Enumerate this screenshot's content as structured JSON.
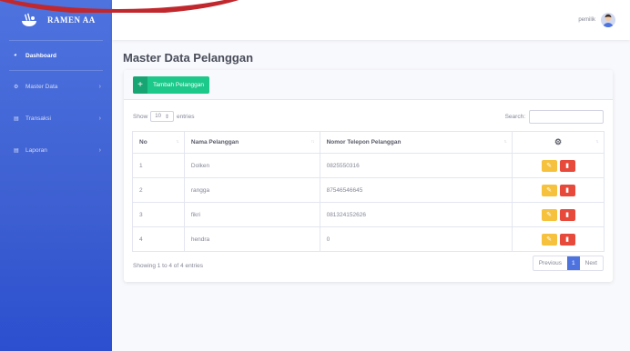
{
  "brand": {
    "name": "RAMEN AA",
    "icon": "ramen-logo-icon"
  },
  "sidebar": {
    "items": [
      {
        "label": "Dashboard",
        "icon": "dashboard-icon"
      },
      {
        "label": "Master Data",
        "icon": "gear-icon"
      },
      {
        "label": "Transaksi",
        "icon": "chart-icon"
      },
      {
        "label": "Laporan",
        "icon": "chart-icon"
      }
    ]
  },
  "topbar": {
    "username": "pemilik",
    "avatar_icon": "user-avatar-icon"
  },
  "page": {
    "title": "Master Data Pelanggan"
  },
  "card": {
    "add_label": "Tambah Pelanggan",
    "show_label": "Show",
    "entries_value": "10",
    "entries_label": "entries",
    "search_label": "Search:",
    "search_value": ""
  },
  "table": {
    "headers": [
      "No",
      "Nama Pelanggan",
      "Nomor Telepon Pelanggan"
    ],
    "action_icon": "cogs-icon",
    "rows": [
      {
        "no": "1",
        "nama": "Dolken",
        "telepon": "0825550316"
      },
      {
        "no": "2",
        "nama": "rangga",
        "telepon": "87546546645"
      },
      {
        "no": "3",
        "nama": "fikri",
        "telepon": "081324152626"
      },
      {
        "no": "4",
        "nama": "hendra",
        "telepon": "0"
      }
    ]
  },
  "footer": {
    "info": "Showing 1 to 4 of 4 entries",
    "previous": "Previous",
    "current_page": "1",
    "next": "Next"
  },
  "colors": {
    "sidebar": "#4e73df",
    "success": "#1cc88a",
    "warning": "#f6c23e",
    "danger": "#e74a3b",
    "swoosh": "#c0282d"
  }
}
